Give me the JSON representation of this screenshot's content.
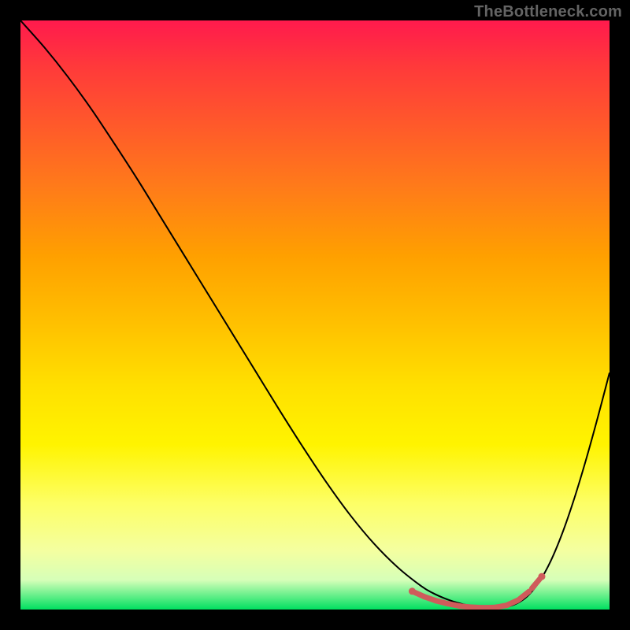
{
  "watermark": "TheBottleneck.com",
  "colors": {
    "curve": "#000000",
    "dots": "#cf5b5b",
    "frame": "#000000"
  },
  "chart_data": {
    "type": "line",
    "title": "",
    "xlabel": "",
    "ylabel": "",
    "xlim": [
      0,
      100
    ],
    "ylim": [
      0,
      100
    ],
    "grid": false,
    "series": [
      {
        "name": "bottleneck-curve",
        "x": [
          0,
          4,
          8,
          12,
          16,
          20,
          24,
          28,
          32,
          36,
          40,
          44,
          48,
          52,
          56,
          60,
          64,
          68,
          70,
          72,
          74,
          76,
          78,
          80,
          82,
          84,
          86,
          88,
          90,
          92,
          94,
          96,
          98,
          100
        ],
        "y": [
          100,
          95.5,
          90.5,
          85,
          79,
          72.8,
          66.3,
          59.8,
          53.3,
          46.8,
          40.3,
          33.8,
          27.5,
          21.5,
          16,
          11.2,
          7.2,
          4,
          2.8,
          1.9,
          1.2,
          0.7,
          0.4,
          0.25,
          0.35,
          0.9,
          2.2,
          4.6,
          8.2,
          13.0,
          18.8,
          25.4,
          32.6,
          40.2
        ]
      }
    ],
    "trough_dots": {
      "name": "optimal-range",
      "x": [
        66.5,
        68.5,
        70.5,
        72.5,
        74.5,
        76.5,
        78.5,
        80.5,
        82.5,
        84.5,
        86.5,
        88.5
      ],
      "y": [
        3.1,
        2.2,
        1.5,
        1.0,
        0.6,
        0.4,
        0.3,
        0.35,
        0.7,
        1.6,
        3.2,
        5.6
      ]
    }
  }
}
